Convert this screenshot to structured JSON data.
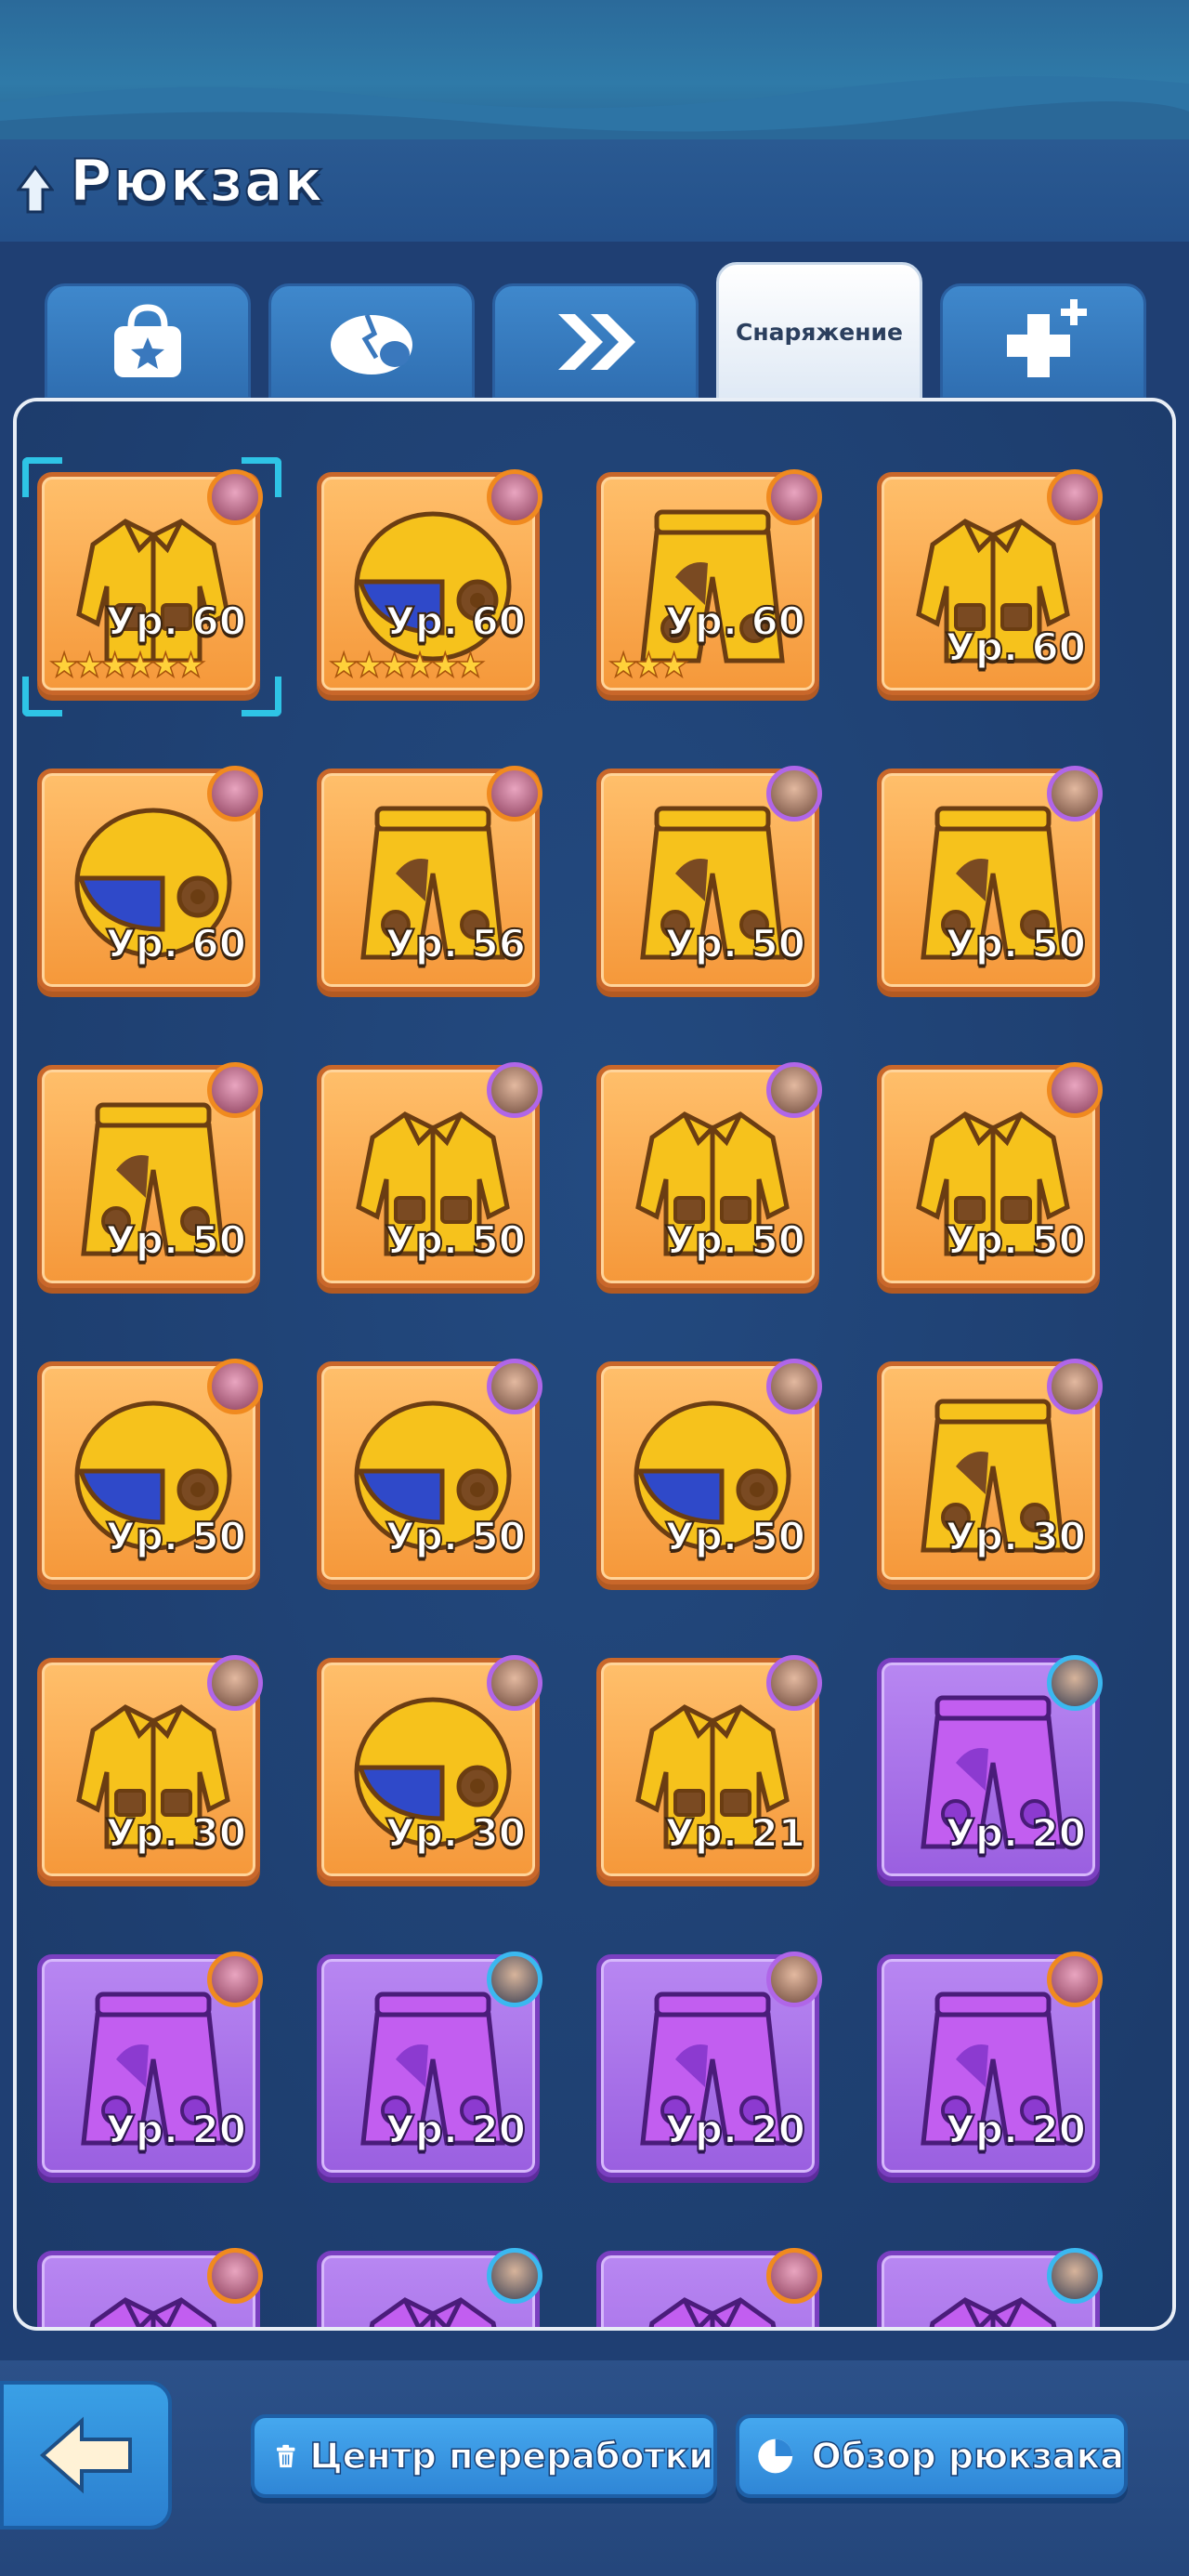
{
  "header": {
    "title": "Рюкзак"
  },
  "tabs": [
    {
      "name": "tab-items",
      "label": "",
      "icon": "bag-star-icon",
      "active": false
    },
    {
      "name": "tab-eggs",
      "label": "",
      "icon": "egg-icon",
      "active": false
    },
    {
      "name": "tab-speedups",
      "label": "",
      "icon": "double-chevron-icon",
      "active": false
    },
    {
      "name": "tab-equipment",
      "label": "Снаряжение",
      "icon": "",
      "active": true
    },
    {
      "name": "tab-boosts",
      "label": "",
      "icon": "plus-icon",
      "active": false
    }
  ],
  "items": [
    {
      "type": "jacket",
      "rarity": "gold",
      "level": "Ур. 60",
      "stars": 6,
      "avatar": "orange",
      "selected": true
    },
    {
      "type": "helmet",
      "rarity": "gold",
      "level": "Ур. 60",
      "stars": 6,
      "avatar": "orange"
    },
    {
      "type": "pants",
      "rarity": "gold",
      "level": "Ур. 60",
      "stars": 3,
      "avatar": "orange"
    },
    {
      "type": "jacket",
      "rarity": "gold",
      "level": "Ур. 60",
      "stars": 0,
      "avatar": "orange"
    },
    {
      "type": "helmet",
      "rarity": "gold",
      "level": "Ур. 60",
      "stars": 0,
      "avatar": "orange"
    },
    {
      "type": "pants",
      "rarity": "gold",
      "level": "Ур. 56",
      "stars": 0,
      "avatar": "orange"
    },
    {
      "type": "pants",
      "rarity": "gold",
      "level": "Ур. 50",
      "stars": 0,
      "avatar": "purple"
    },
    {
      "type": "pants",
      "rarity": "gold",
      "level": "Ур. 50",
      "stars": 0,
      "avatar": "purple"
    },
    {
      "type": "pants",
      "rarity": "gold",
      "level": "Ур. 50",
      "stars": 0,
      "avatar": "orange"
    },
    {
      "type": "jacket",
      "rarity": "gold",
      "level": "Ур. 50",
      "stars": 0,
      "avatar": "purple"
    },
    {
      "type": "jacket",
      "rarity": "gold",
      "level": "Ур. 50",
      "stars": 0,
      "avatar": "purple"
    },
    {
      "type": "jacket",
      "rarity": "gold",
      "level": "Ур. 50",
      "stars": 0,
      "avatar": "orange"
    },
    {
      "type": "helmet",
      "rarity": "gold",
      "level": "Ур. 50",
      "stars": 0,
      "avatar": "orange"
    },
    {
      "type": "helmet",
      "rarity": "gold",
      "level": "Ур. 50",
      "stars": 0,
      "avatar": "purple"
    },
    {
      "type": "helmet",
      "rarity": "gold",
      "level": "Ур. 50",
      "stars": 0,
      "avatar": "purple"
    },
    {
      "type": "pants",
      "rarity": "gold",
      "level": "Ур. 30",
      "stars": 0,
      "avatar": "purple"
    },
    {
      "type": "jacket",
      "rarity": "gold",
      "level": "Ур. 30",
      "stars": 0,
      "avatar": "purple"
    },
    {
      "type": "helmet",
      "rarity": "gold",
      "level": "Ур. 30",
      "stars": 0,
      "avatar": "purple"
    },
    {
      "type": "jacket",
      "rarity": "gold",
      "level": "Ур. 21",
      "stars": 0,
      "avatar": "purple"
    },
    {
      "type": "pants",
      "rarity": "purple",
      "level": "Ур. 20",
      "stars": 0,
      "avatar": "blue"
    },
    {
      "type": "pants",
      "rarity": "purple",
      "level": "Ур. 20",
      "stars": 0,
      "avatar": "orange"
    },
    {
      "type": "pants",
      "rarity": "purple",
      "level": "Ур. 20",
      "stars": 0,
      "avatar": "blue"
    },
    {
      "type": "pants",
      "rarity": "purple",
      "level": "Ур. 20",
      "stars": 0,
      "avatar": "purple"
    },
    {
      "type": "pants",
      "rarity": "purple",
      "level": "Ур. 20",
      "stars": 0,
      "avatar": "orange"
    },
    {
      "type": "jacket",
      "rarity": "purple",
      "level": "",
      "stars": 0,
      "avatar": "orange"
    },
    {
      "type": "jacket",
      "rarity": "purple",
      "level": "",
      "stars": 0,
      "avatar": "blue"
    },
    {
      "type": "jacket",
      "rarity": "purple",
      "level": "",
      "stars": 0,
      "avatar": "orange"
    },
    {
      "type": "jacket",
      "rarity": "purple",
      "level": "",
      "stars": 0,
      "avatar": "blue"
    }
  ],
  "footer": {
    "back_icon": "back-arrow-icon",
    "recycle_label": "Центр переработки",
    "recycle_icon": "trash-icon",
    "overview_label": "Обзор рюкзака",
    "overview_icon": "pie-chart-icon"
  }
}
